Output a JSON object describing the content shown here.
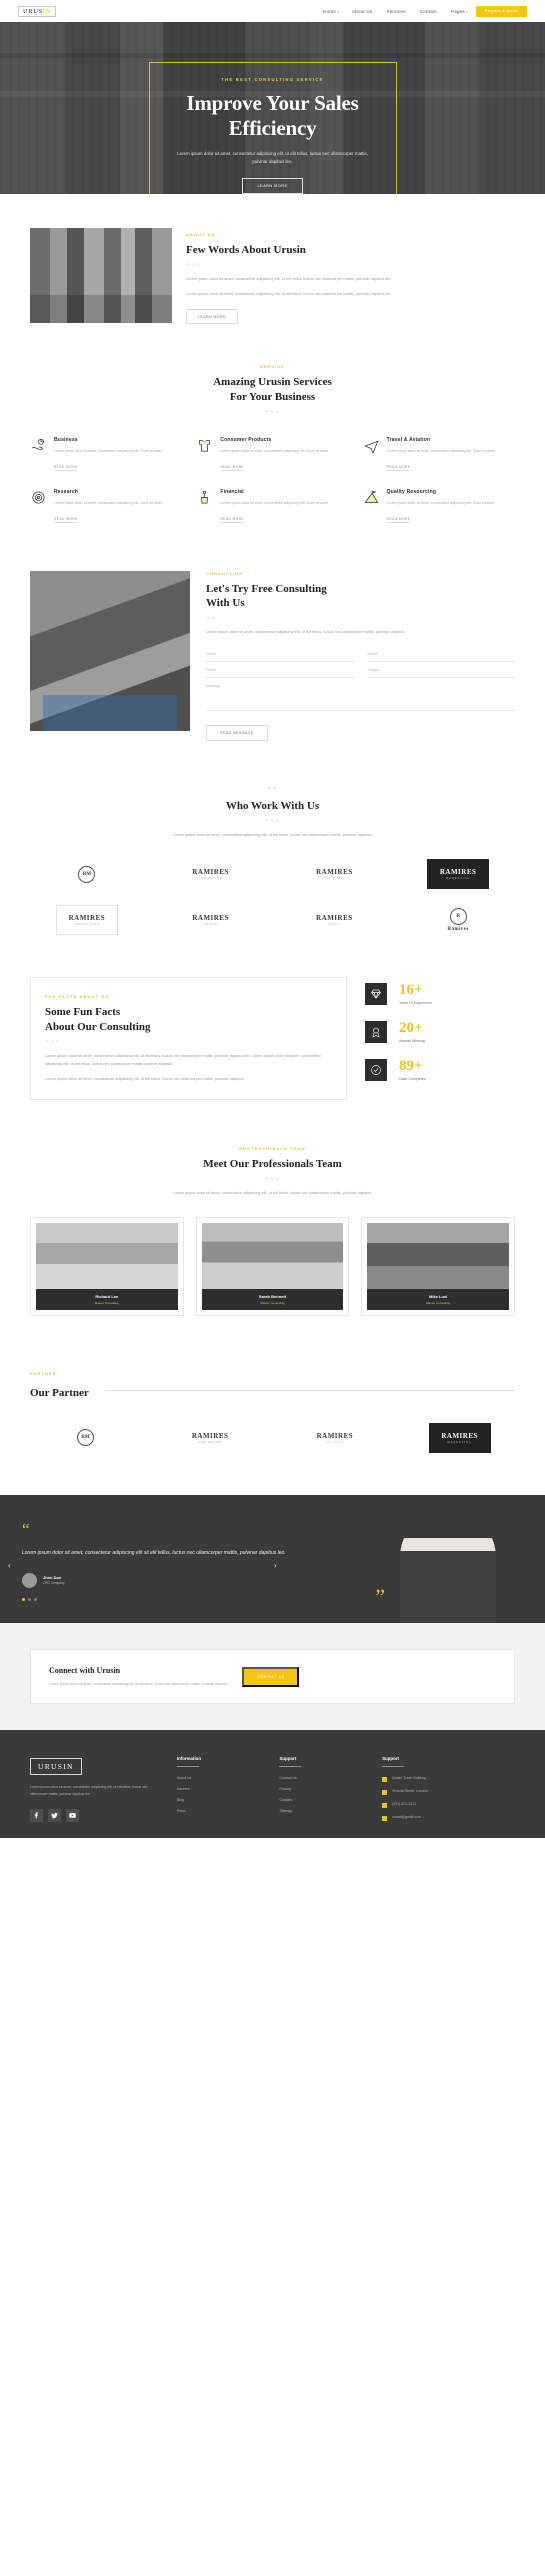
{
  "header": {
    "logo": "URUS",
    "logo_accent": "IN",
    "nav": [
      {
        "label": "Home",
        "caret": "▾"
      },
      {
        "label": "About Us",
        "caret": ""
      },
      {
        "label": "Services",
        "caret": ""
      },
      {
        "label": "Contact",
        "caret": ""
      },
      {
        "label": "Pages",
        "caret": "▾"
      }
    ],
    "quote_button": "Request A Quote"
  },
  "hero": {
    "eyebrow": "THE BEST CONSULTING SERVICE",
    "title_line1": "Improve Your Sales",
    "title_line2": "Efficiency",
    "subtitle": "Lorem ipsum dolor sit amet, consectetur adipiscing elit, ut elit tellus, luctus nec ullamcorper mattis, pulvinar dapibus leo.",
    "button": "LEARN MORE"
  },
  "about": {
    "eyebrow": "ABOUT US",
    "title": "Few Words About Urusin",
    "squiggle": "∿∿∿",
    "paragraph1": "Lorem ipsum dolor sit amet, consectetur adipiscing elit, ut elit tellus, luctus nec ullamcorper mattis, pulvinar dapibus leo.",
    "paragraph2": "Lorem ipsum dolor sit amet, consectetur adipiscing elit, ut elit tellus, luctus nec ullamcorper mattis, pulvinar dapibus leo.",
    "button": "LEARN MORE"
  },
  "services": {
    "eyebrow": "SERVICE",
    "title_line1": "Amazing Urusin Services",
    "title_line2": "For Your Business",
    "squiggle": "∿∿∿",
    "read_more": "READ MORE",
    "items": [
      {
        "icon": "hand-chart-icon",
        "title": "Business",
        "text": "Lorem ipsum dolor sit amet, consectetur adipiscing elit. Done sit amet."
      },
      {
        "icon": "shirt-icon",
        "title": "Consumer Products",
        "text": "Lorem ipsum dolor sit amet, consectetur adipiscing elit. Done sit amet."
      },
      {
        "icon": "plane-icon",
        "title": "Travel & Aviation",
        "text": "Lorem ipsum dolor sit amet, consectetur adipiscing elit. Done sit amet."
      },
      {
        "icon": "microscope-icon",
        "title": "Research",
        "text": "Lorem ipsum dolor sit amet, consectetur adipiscing elit. Done sit amet."
      },
      {
        "icon": "plant-pot-icon",
        "title": "Financial",
        "text": "Lorem ipsum dolor sit amet, consectetur adipiscing elit. Done sit amet."
      },
      {
        "icon": "mountain-flag-icon",
        "title": "Quality Resourcing",
        "text": "Lorem ipsum dolor sit amet, consectetur adipiscing elit. Done sit amet."
      }
    ]
  },
  "consulting": {
    "eyebrow": "CONSULTING",
    "title_line1": "Let's Try Free Consulting",
    "title_line2": "With Us",
    "squiggle": "∿∿",
    "description": "Lorem ipsum dolor sit amet, consectetur adipiscing elit, ut elit tellus, luctus nec ullamcorper mattis, pulvinar dapibus.",
    "fields": {
      "name": "Name",
      "email": "Email*",
      "phone": "Phone",
      "subject": "Subject",
      "message": "Message"
    },
    "button": "SEND MESSAGE"
  },
  "clients": {
    "squiggle_top": "∿∿",
    "title": "Who Work With Us",
    "squiggle": "∿∿∿",
    "description": "Lorem ipsum dolor sit amet, consectetur adipiscing elit, ut elit tellus, luctus nec ullamcorper mattis, pulvinar dapibus.",
    "logos": [
      {
        "style": "circle",
        "mark": "RM",
        "sub": ""
      },
      {
        "style": "plain",
        "mark": "RAMIRES",
        "sub": "THE BRAND"
      },
      {
        "style": "plain",
        "mark": "RAMIRES",
        "sub": "for Style"
      },
      {
        "style": "dark",
        "mark": "RAMIRES",
        "sub": "MARKETING"
      },
      {
        "style": "box",
        "mark": "RAMIRES",
        "sub": "CONSULTING"
      },
      {
        "style": "plain",
        "mark": "RAMIRES",
        "sub": "GROUP"
      },
      {
        "style": "plain",
        "mark": "RAMIRES",
        "sub": "studio"
      },
      {
        "style": "circle-r",
        "mark": "Ramires",
        "sub": ""
      }
    ]
  },
  "facts": {
    "eyebrow": "FUN FACTS ABOUT US",
    "title_line1": "Some Fun Facts",
    "title_line2": "About Our Consulting",
    "squiggle": "∿∿∿",
    "paragraph1": "Lorem ipsum dolor sit amet, consectetur adipiscing elit, ut elit tellus, luctus nec ullamcorper mattis, pulvinar dapibus leo. Lorem ipsum dolor sit amet, consectetur adipiscing elit, ut elit tellus, luctus nec ullamcorper mattis pulvinar dapibus.",
    "paragraph2": "Lorem ipsum dolor sit amet, consectetur adipiscing elit, ut elit tellus, luctus nec ullamcorper mattis, pulvinar dapibus.",
    "stats": [
      {
        "icon": "diamond-icon",
        "number": "16+",
        "label": "Years Of Experience"
      },
      {
        "icon": "award-icon",
        "number": "20+",
        "label": "Awards Winning"
      },
      {
        "icon": "check-badge-icon",
        "number": "89+",
        "label": "Case Completed"
      }
    ]
  },
  "team": {
    "eyebrow": "PROFESSIONALS TEAM",
    "title": "Meet Our Professionals Team",
    "squiggle": "∿∿∿",
    "description": "Lorem ipsum dolor sit amet, consectetur adipiscing elit, ut elit tellus, luctus nec ullamcorper mattis, pulvinar dapibus.",
    "members": [
      {
        "name": "Richard Lee",
        "role": "Master Consulting"
      },
      {
        "name": "Sarah Bennett",
        "role": "Master Consulting"
      },
      {
        "name": "Mike Luel",
        "role": "Master Consulting"
      }
    ]
  },
  "partner": {
    "eyebrow": "PARTNER",
    "title": "Our Partner",
    "logos": [
      {
        "style": "circle",
        "mark": "RM",
        "sub": ""
      },
      {
        "style": "plain",
        "mark": "RAMIRES",
        "sub": "THE BRAND"
      },
      {
        "style": "plain",
        "mark": "RAMIRES",
        "sub": "for Style"
      },
      {
        "style": "dark",
        "mark": "RAMIRES",
        "sub": "MARKETING"
      }
    ]
  },
  "testimonial": {
    "quote": "Lorem ipsum dolor sit amet, consectetur adipiscing elit sit elit tellus, luctus nec ullamcorper mattis, pulvinar dapibus leo.",
    "author": "Jhon Doe",
    "role": "CEO Company",
    "open_quote": "“",
    "close_quote": "”",
    "prev": "‹",
    "next": "›"
  },
  "cta": {
    "title": "Connect with Urusin",
    "description": "Lorem ipsum dolor sit amet, consectetur adipiscing elit, ut elit tellus, luctus nec ullamcorper mattis, pulvinar dapibus.",
    "button": "CONTACT US"
  },
  "footer": {
    "logo": "URUSIN",
    "description": "Lorem ipsum dolor sit amet, consectetur adipiscing elit, ut elit tellus, luctus nec ullamcorper mattis, pulvinar dapibus leo.",
    "socials": [
      "facebook-icon",
      "twitter-icon",
      "youtube-icon"
    ],
    "columns": [
      {
        "title": "Information",
        "links": [
          "About Us",
          "Careers",
          "Blog",
          "Press"
        ]
      },
      {
        "title": "Support",
        "links": [
          "Contact Us",
          "Privacy",
          "Cookies",
          "Sitemap"
        ]
      }
    ],
    "contact": {
      "title": "Support",
      "items": [
        {
          "icon": "building-icon",
          "text": "Urusin Tower Building"
        },
        {
          "icon": "pin-icon",
          "text": "Victoria Street, London"
        },
        {
          "icon": "phone-icon",
          "text": "(021) 622-3412"
        },
        {
          "icon": "mail-icon",
          "text": "cotact@gmail.com"
        }
      ]
    }
  }
}
